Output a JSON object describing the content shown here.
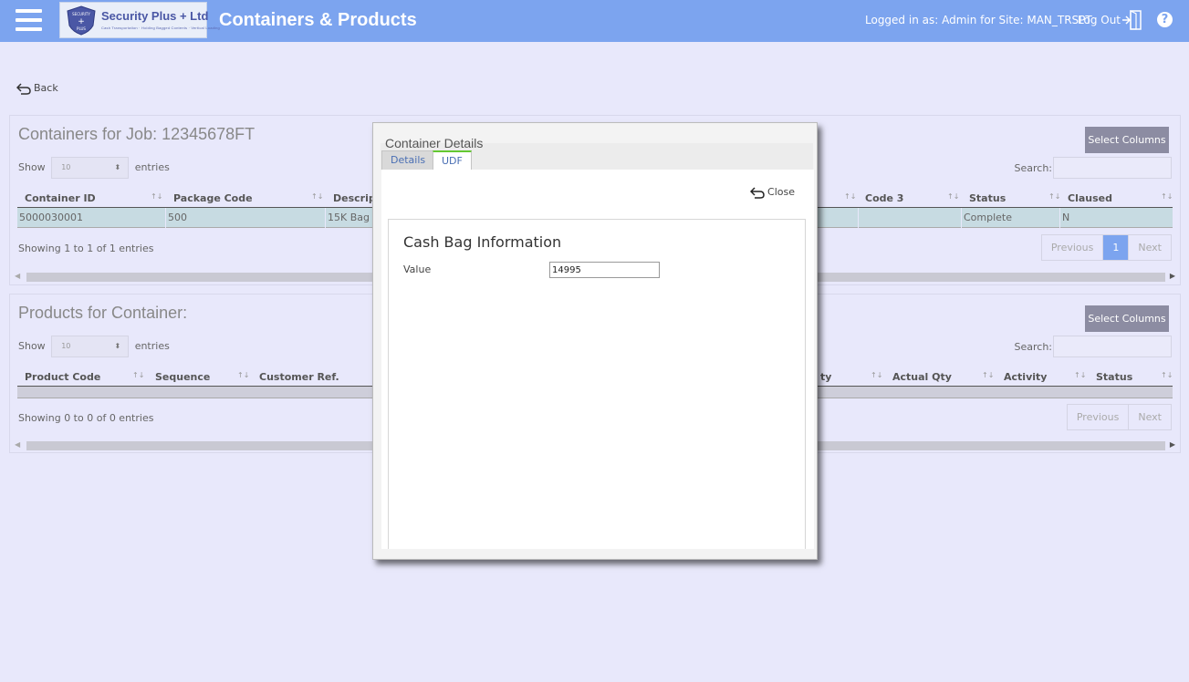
{
  "header": {
    "brand": "Security Plus + Ltd",
    "brand_tagline": "Cash Transportation · Holding Bagged Contents · Vertical Loading",
    "logo_shield_top": "SECURITY",
    "logo_shield_bottom": "PLUS",
    "title": "Containers & Products",
    "login_info": "Logged in as: Admin for Site: MAN_TRSPT",
    "logout": "Log Out",
    "help": "?",
    "bg_color": "#7ca4ef"
  },
  "back_label": "Back",
  "containers": {
    "title": "Containers for Job: 12345678FT",
    "select_columns": "Select Columns",
    "show_label": "Show",
    "page_length": "10",
    "entries_label": "entries",
    "search_label": "Search:",
    "columns": [
      "Container ID",
      "Package Code",
      "Descript",
      "ty",
      "Code 3",
      "Status",
      "Claused"
    ],
    "rows": [
      [
        "5000030001",
        "500",
        "15K Bag",
        "",
        "",
        "Complete",
        "N"
      ]
    ],
    "info": "Showing 1 to 1 of 1 entries",
    "pager": {
      "previous": "Previous",
      "current": "1",
      "next": "Next"
    }
  },
  "products": {
    "title": "Products for Container:",
    "select_columns": "Select Columns",
    "show_label": "Show",
    "page_length": "10",
    "entries_label": "entries",
    "search_label": "Search:",
    "columns": [
      "Product Code",
      "Sequence",
      "Customer Ref.",
      "ty",
      "Actual Qty",
      "Activity",
      "Status"
    ],
    "info": "Showing 0 to 0 of 0 entries",
    "pager": {
      "previous": "Previous",
      "next": "Next"
    }
  },
  "modal": {
    "title": "Container Details",
    "tabs": [
      "Details",
      "UDF"
    ],
    "active_tab": "UDF",
    "close": "Close",
    "section_title": "Cash Bag Information",
    "field_label": "Value",
    "field_value": "14995"
  }
}
